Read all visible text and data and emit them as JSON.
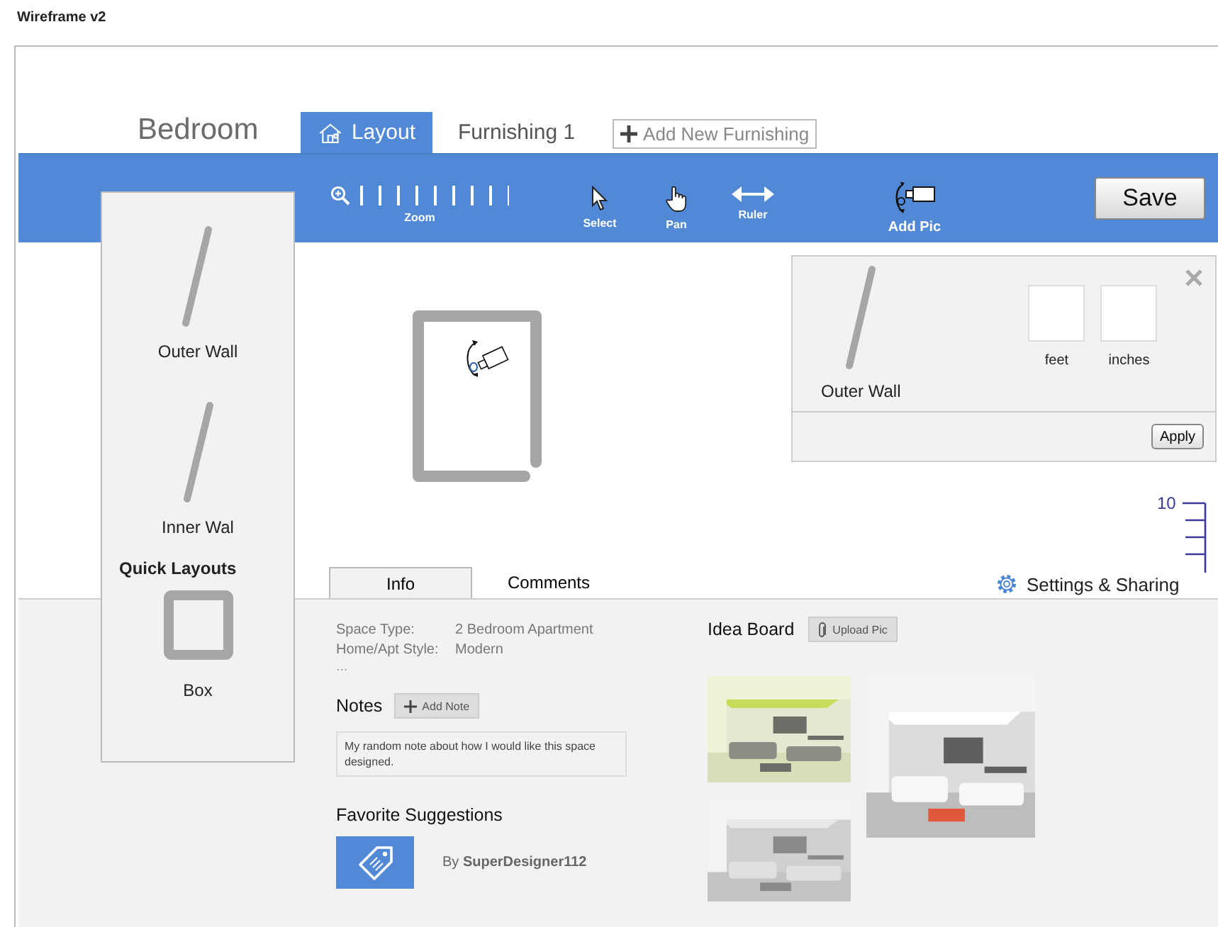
{
  "app_title": "Wireframe v2",
  "header": {
    "room_name": "Bedroom",
    "tabs": [
      {
        "label": "Layout",
        "selected": true,
        "kind": "home"
      },
      {
        "label": "Furnishing 1",
        "selected": false,
        "kind": "plain"
      }
    ],
    "add_button": "Add New Furnishing"
  },
  "toolbar": {
    "zoom_label": "Zoom",
    "tools": [
      {
        "label": "Select",
        "kind": "select"
      },
      {
        "label": "Pan",
        "kind": "pan"
      },
      {
        "label": "Ruler",
        "kind": "ruler"
      }
    ],
    "add_pic": "Add Pic",
    "save": "Save"
  },
  "quick_panel": {
    "walls": [
      {
        "label": "Outer Wall"
      },
      {
        "label": "Inner Wal"
      }
    ],
    "heading": "Quick Layouts",
    "layouts": [
      {
        "label": "Box"
      }
    ]
  },
  "wall_editor": {
    "title": "Outer Wall",
    "fields": [
      {
        "label": "feet"
      },
      {
        "label": "inches"
      }
    ],
    "apply": "Apply"
  },
  "ruler": {
    "label": "10"
  },
  "info_tabs": [
    {
      "label": "Info",
      "selected": true
    },
    {
      "label": "Comments",
      "selected": false
    }
  ],
  "settings_link": "Settings & Sharing",
  "info": {
    "details": [
      {
        "label": "Space Type:",
        "value": "2 Bedroom Apartment"
      },
      {
        "label": "Home/Apt Style:",
        "value": "Modern"
      }
    ],
    "more": "...",
    "notes_heading": "Notes",
    "add_note": "Add Note",
    "note": "My random note about how I would like this space designed.",
    "suggestions_heading": "Favorite Suggestions",
    "suggestions": [
      {
        "author": "By **SuperDesigner112**"
      }
    ]
  },
  "idea_board": {
    "heading": "Idea Board",
    "upload": "Upload Pic"
  }
}
